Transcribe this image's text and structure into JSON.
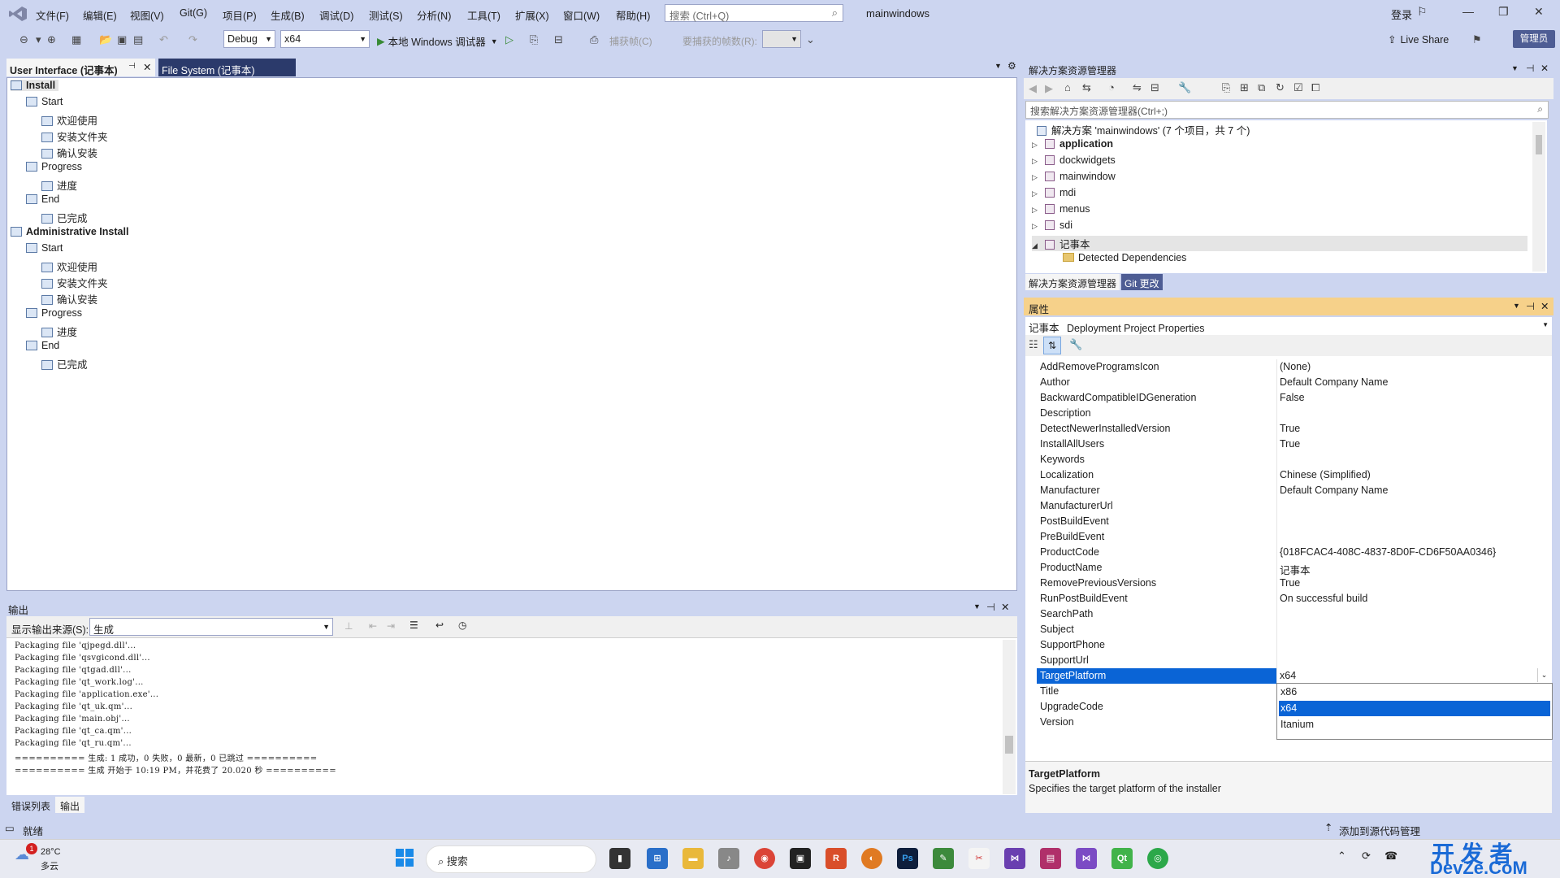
{
  "titlebar": {
    "menus": [
      "文件(F)",
      "编辑(E)",
      "视图(V)",
      "Git(G)",
      "项目(P)",
      "生成(B)",
      "调试(D)",
      "测试(S)",
      "分析(N)",
      "工具(T)",
      "扩展(X)",
      "窗口(W)",
      "帮助(H)"
    ],
    "search_placeholder": "搜索 (Ctrl+Q)",
    "solution_name": "mainwindows",
    "login": "登录"
  },
  "toolbar": {
    "config": "Debug",
    "platform": "x64",
    "run_label": "本地 Windows 调试器",
    "capture_label": "捕获帧(C)",
    "frames_label": "要捕获的帧数(R):",
    "live_share": "Live Share",
    "manage": "管理员"
  },
  "doc_tabs": {
    "tab1": "User Interface (记事本)",
    "tab2": "File System (记事本)"
  },
  "ui_tree": [
    {
      "label": "Install",
      "level": 0,
      "bold": true
    },
    {
      "label": "Start",
      "level": 1
    },
    {
      "label": "欢迎使用",
      "level": 2
    },
    {
      "label": "安装文件夹",
      "level": 2
    },
    {
      "label": "确认安装",
      "level": 2
    },
    {
      "label": "Progress",
      "level": 1
    },
    {
      "label": "进度",
      "level": 2
    },
    {
      "label": "End",
      "level": 1
    },
    {
      "label": "已完成",
      "level": 2
    },
    {
      "label": "Administrative Install",
      "level": 0,
      "bold": true
    },
    {
      "label": "Start",
      "level": 1
    },
    {
      "label": "欢迎使用",
      "level": 2
    },
    {
      "label": "安装文件夹",
      "level": 2
    },
    {
      "label": "确认安装",
      "level": 2
    },
    {
      "label": "Progress",
      "level": 1
    },
    {
      "label": "进度",
      "level": 2
    },
    {
      "label": "End",
      "level": 1
    },
    {
      "label": "已完成",
      "level": 2
    }
  ],
  "output": {
    "title": "输出",
    "source_label": "显示输出来源(S):",
    "source_value": "生成",
    "lines": [
      "Packaging file 'qjpegd.dll'...",
      "Packaging file 'qsvgicond.dll'...",
      "Packaging file 'qtgad.dll'...",
      "Packaging file 'qt_work.log'...",
      "Packaging file 'application.exe'...",
      "Packaging file 'qt_uk.qm'...",
      "Packaging file 'main.obj'...",
      "Packaging file 'qt_ca.qm'...",
      "Packaging file 'qt_ru.qm'...",
      "========== 生成: 1 成功，0 失败，0 最新，0 已跳过 ==========",
      "========== 生成 开始于 10:19 PM，并花费了 20.020 秒 =========="
    ],
    "tabs": [
      "错误列表",
      "输出"
    ]
  },
  "solution_explorer": {
    "title": "解决方案资源管理器",
    "search_placeholder": "搜索解决方案资源管理器(Ctrl+;)",
    "solution_line": "解决方案 'mainwindows' (7 个项目，共 7 个)",
    "projects": [
      {
        "label": "application",
        "bold": true
      },
      {
        "label": "dockwidgets"
      },
      {
        "label": "mainwindow"
      },
      {
        "label": "mdi"
      },
      {
        "label": "menus"
      },
      {
        "label": "sdi"
      },
      {
        "label": "记事本",
        "expanded": true
      }
    ],
    "child": "Detected Dependencies",
    "tabs": [
      "解决方案资源管理器",
      "Git 更改"
    ]
  },
  "properties": {
    "title": "属性",
    "object": "记事本",
    "object_type": "Deployment Project Properties",
    "rows": [
      {
        "name": "AddRemoveProgramsIcon",
        "value": "(None)"
      },
      {
        "name": "Author",
        "value": "Default Company Name"
      },
      {
        "name": "BackwardCompatibleIDGeneration",
        "value": "False"
      },
      {
        "name": "Description",
        "value": ""
      },
      {
        "name": "DetectNewerInstalledVersion",
        "value": "True"
      },
      {
        "name": "InstallAllUsers",
        "value": "True"
      },
      {
        "name": "Keywords",
        "value": ""
      },
      {
        "name": "Localization",
        "value": "Chinese (Simplified)"
      },
      {
        "name": "Manufacturer",
        "value": "Default Company Name"
      },
      {
        "name": "ManufacturerUrl",
        "value": ""
      },
      {
        "name": "PostBuildEvent",
        "value": ""
      },
      {
        "name": "PreBuildEvent",
        "value": ""
      },
      {
        "name": "ProductCode",
        "value": "{018FCAC4-408C-4837-8D0F-CD6F50AA0346}"
      },
      {
        "name": "ProductName",
        "value": "记事本"
      },
      {
        "name": "RemovePreviousVersions",
        "value": "True"
      },
      {
        "name": "RunPostBuildEvent",
        "value": "On successful build"
      },
      {
        "name": "SearchPath",
        "value": ""
      },
      {
        "name": "Subject",
        "value": ""
      },
      {
        "name": "SupportPhone",
        "value": ""
      },
      {
        "name": "SupportUrl",
        "value": ""
      },
      {
        "name": "TargetPlatform",
        "value": "x64",
        "selected": true
      },
      {
        "name": "Title",
        "value": ""
      },
      {
        "name": "UpgradeCode",
        "value": ""
      },
      {
        "name": "Version",
        "value": ""
      }
    ],
    "dropdown_options": [
      "x86",
      "x64",
      "Itanium"
    ],
    "dropdown_selected": "x64",
    "desc_title": "TargetPlatform",
    "desc_text": "Specifies the target platform of the installer"
  },
  "statusbar": {
    "ready": "就绪",
    "source_control": "添加到源代码管理"
  },
  "taskbar": {
    "weather_temp": "28°C",
    "weather_desc": "多云",
    "search": "搜索",
    "watermark_top": "开 发 者",
    "watermark_bottom": "DevZe.CoM"
  },
  "colors": {
    "accent": "#0a64d6",
    "titlebar_bg": "#ccd5f0",
    "props_header": "#f6d18a",
    "dark_tab": "#2b3a6b"
  }
}
